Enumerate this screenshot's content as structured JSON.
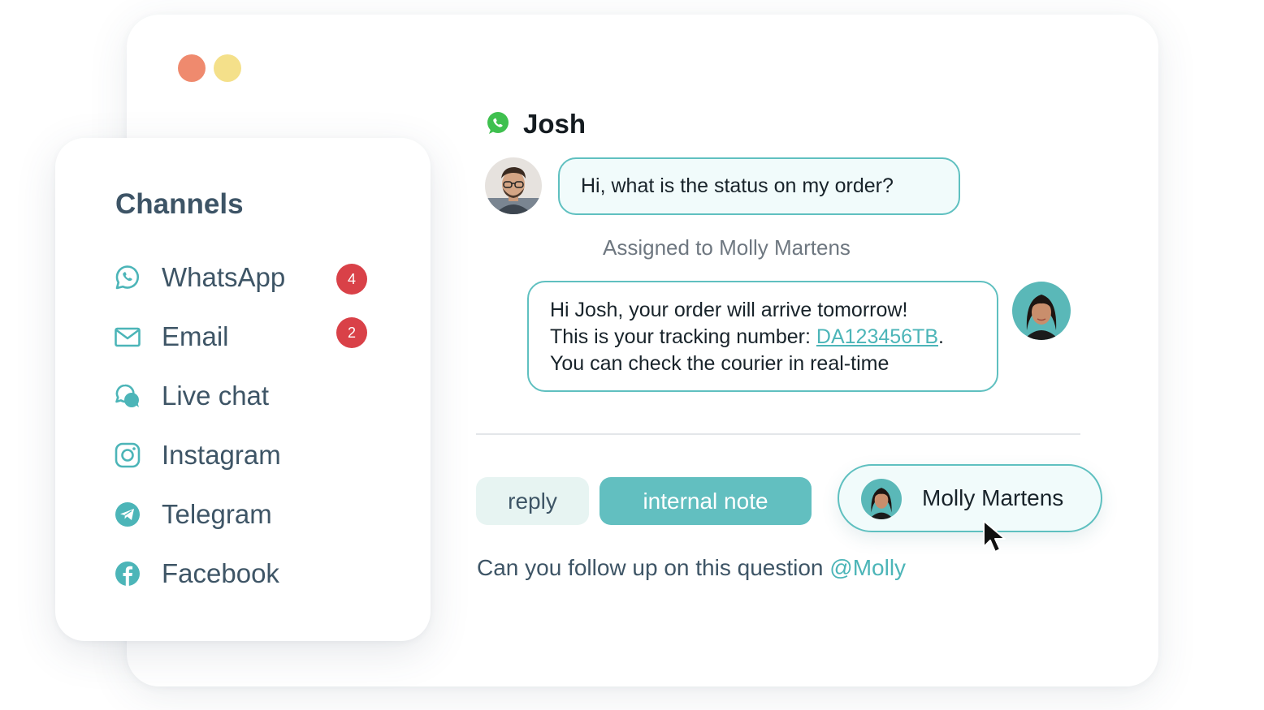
{
  "colors": {
    "accent": "#62bfc0",
    "accent_light": "#e7f4f2",
    "badge": "#d94148",
    "window_dot_red": "#ef8a6e",
    "window_dot_yellow": "#f4e08a",
    "whatsapp_green": "#3fc04f",
    "icon_teal": "#4cb5b8"
  },
  "window": {
    "controls": [
      "close-dot",
      "minimize-dot"
    ]
  },
  "channels": {
    "title": "Channels",
    "items": [
      {
        "label": "WhatsApp",
        "icon": "whatsapp-icon",
        "badge": "4"
      },
      {
        "label": "Email",
        "icon": "mail-icon",
        "badge": "2"
      },
      {
        "label": "Live chat",
        "icon": "chat-bubbles-icon"
      },
      {
        "label": "Instagram",
        "icon": "instagram-icon"
      },
      {
        "label": "Telegram",
        "icon": "telegram-icon"
      },
      {
        "label": "Facebook",
        "icon": "facebook-icon"
      }
    ]
  },
  "conversation": {
    "contact_name": "Josh",
    "contact_channel_icon": "whatsapp-icon",
    "incoming_message": "Hi, what is the status on my order?",
    "assigned_text": "Assigned to Molly Martens",
    "outgoing_message": {
      "line1": "Hi Josh, your order will arrive tomorrow!",
      "line2_prefix": "This is your tracking number: ",
      "tracking_number": "DA123456TB",
      "line2_suffix": ".",
      "line3": "You can check the courier in real-time"
    }
  },
  "composer": {
    "reply_label": "reply",
    "internal_note_label": "internal note",
    "note_text": "Can you follow up on this question ",
    "mention": "@Molly",
    "mention_suggestion": "Molly Martens"
  }
}
